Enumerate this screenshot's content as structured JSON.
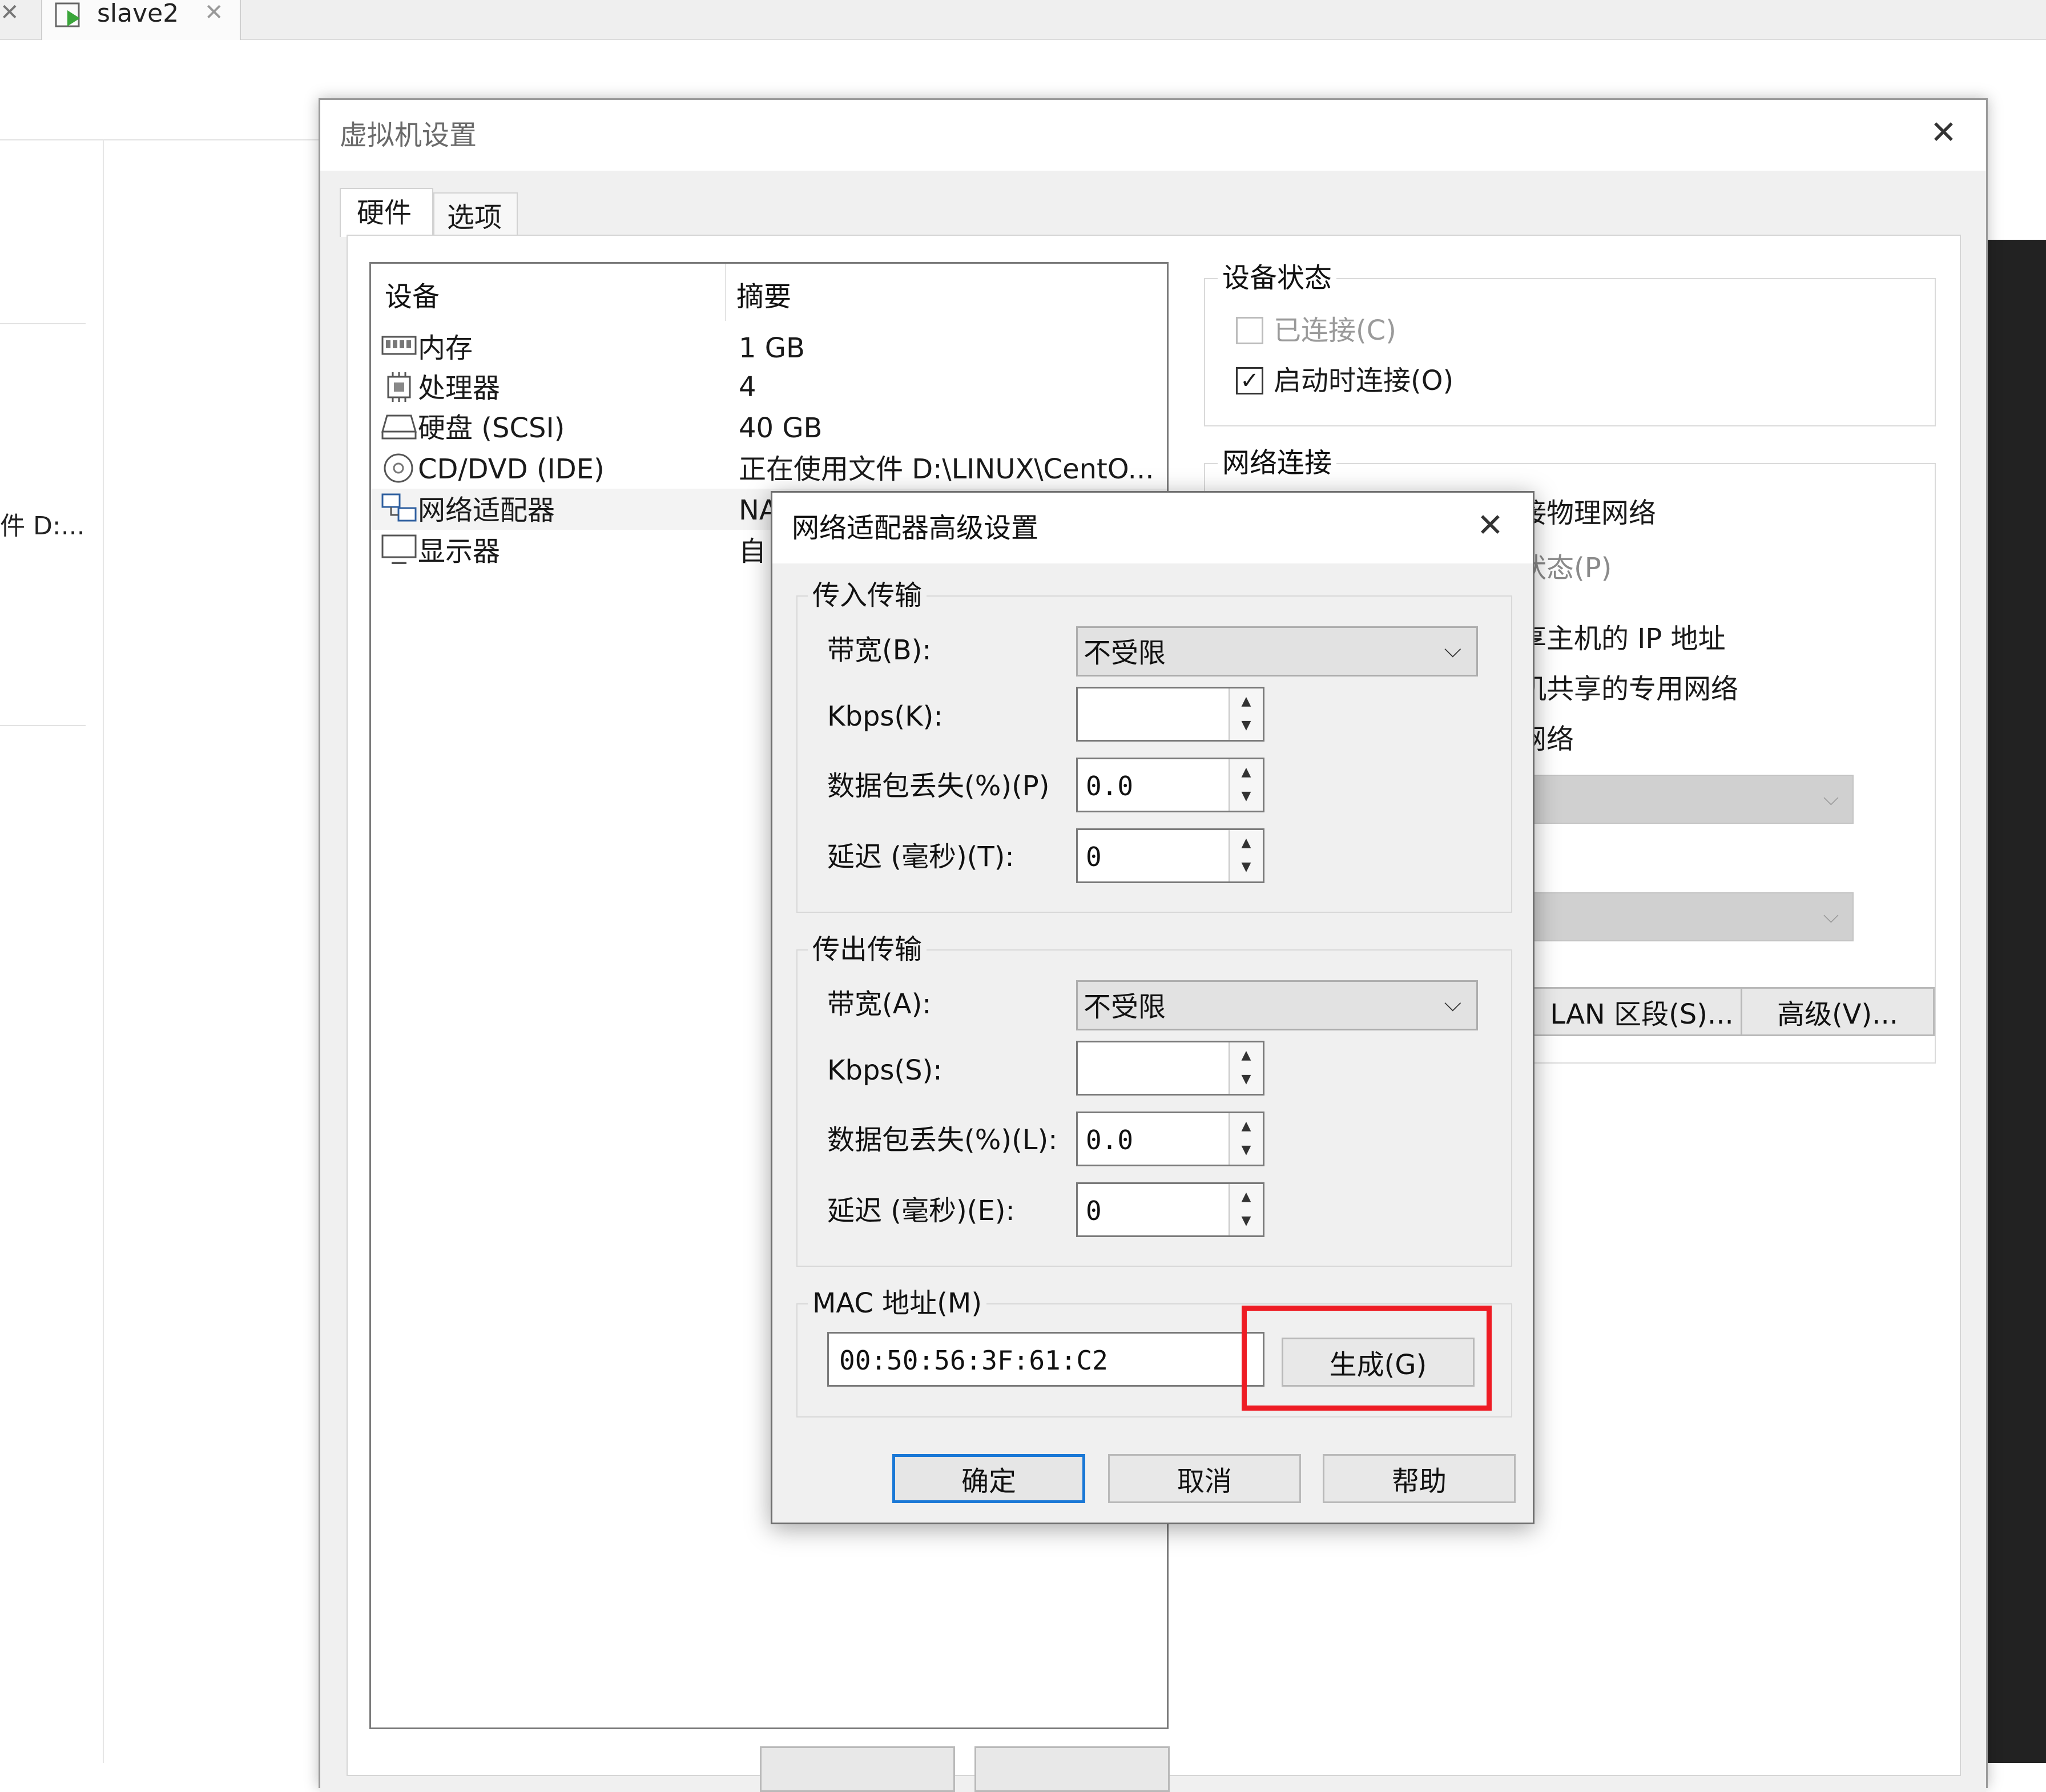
{
  "host": {
    "tab_title": "slave2",
    "left_fragment": "件 D:..."
  },
  "vm_settings": {
    "title": "虚拟机设置",
    "tabs": [
      {
        "label": "硬件",
        "active": true
      },
      {
        "label": "选项",
        "active": false
      }
    ],
    "device_list": {
      "headers": {
        "device": "设备",
        "summary": "摘要"
      },
      "rows": [
        {
          "icon": "memory-icon",
          "device": "内存",
          "summary": "1 GB"
        },
        {
          "icon": "cpu-icon",
          "device": "处理器",
          "summary": "4"
        },
        {
          "icon": "harddisk-icon",
          "device": "硬盘 (SCSI)",
          "summary": "40 GB"
        },
        {
          "icon": "cd-dvd-icon",
          "device": "CD/DVD (IDE)",
          "summary": "正在使用文件 D:\\LINUX\\CentO..."
        },
        {
          "icon": "network-adapter-icon",
          "device": "网络适配器",
          "summary": "NA",
          "selected": true
        },
        {
          "icon": "display-icon",
          "device": "显示器",
          "summary": "自"
        }
      ]
    },
    "device_status": {
      "title": "设备状态",
      "connected": {
        "label": "已连接(C)",
        "checked": false,
        "enabled": false
      },
      "connect_at_power_on": {
        "label": "启动时连接(O)",
        "checked": true
      }
    },
    "network_connection": {
      "title": "网络连接",
      "options": [
        "接物理网络",
        "状态(P)",
        "享主机的 IP 地址",
        "机共享的专用网络",
        "网络"
      ]
    },
    "buttons": {
      "lan_segment": "LAN 区段(S)...",
      "advanced": "高级(V)..."
    }
  },
  "advanced_dialog": {
    "title": "网络适配器高级设置",
    "incoming": {
      "title": "传入传输",
      "bandwidth_label": "带宽(B):",
      "bandwidth_value": "不受限",
      "kbps_label": "Kbps(K):",
      "kbps_value": "",
      "packet_loss_label": "数据包丢失(%)(P)",
      "packet_loss_value": "0.0",
      "latency_label": "延迟 (毫秒)(T):",
      "latency_value": "0"
    },
    "outgoing": {
      "title": "传出传输",
      "bandwidth_label": "带宽(A):",
      "bandwidth_value": "不受限",
      "kbps_label": "Kbps(S):",
      "kbps_value": "",
      "packet_loss_label": "数据包丢失(%)(L):",
      "packet_loss_value": "0.0",
      "latency_label": "延迟 (毫秒)(E):",
      "latency_value": "0"
    },
    "mac": {
      "title": "MAC 地址(M)",
      "value": "00:50:56:3F:61:C2",
      "generate_button": "生成(G)"
    },
    "buttons": {
      "ok": "确定",
      "cancel": "取消",
      "help": "帮助"
    }
  },
  "colors": {
    "highlight": "#ee1c24",
    "primary_border": "#1a78d6"
  }
}
